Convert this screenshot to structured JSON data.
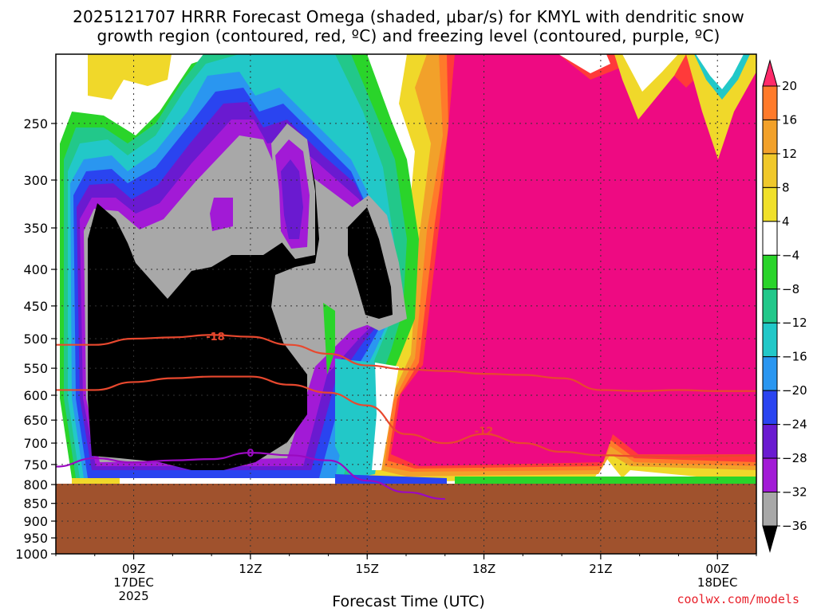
{
  "title_line1": "2025121707 HRRR Forecast Omega (shaded, μbar/s) for KMYL with dendritic snow",
  "title_line2": "growth region (contoured, red, ºC) and freezing level (contoured, purple, ºC)",
  "x_axis_title": "Forecast Time (UTC)",
  "credit": "coolwx.com/models",
  "colors": {
    "ground": "#a0522d",
    "contour_red": "#e8482e",
    "contour_purple": "#9a0ac0"
  },
  "chart_data": {
    "type": "heatmap",
    "title": "2025121707 HRRR Forecast Omega (shaded, μbar/s) for KMYL with dendritic snow growth region (contoured, red, ºC) and freezing level (contoured, purple, ºC)",
    "xlabel": "Forecast Time (UTC)",
    "ylabel": "",
    "x_range_hours": [
      7,
      25
    ],
    "y_scale": "log-pressure",
    "y_range_hpa": [
      200,
      1000
    ],
    "y_ticks": [
      250,
      300,
      350,
      400,
      450,
      500,
      550,
      600,
      650,
      700,
      750,
      800,
      850,
      900,
      950,
      1000
    ],
    "x_ticks": [
      {
        "hour": 9,
        "lines": [
          "09Z",
          "17DEC",
          "2025"
        ]
      },
      {
        "hour": 12,
        "lines": [
          "12Z"
        ]
      },
      {
        "hour": 15,
        "lines": [
          "15Z"
        ]
      },
      {
        "hour": 18,
        "lines": [
          "18Z"
        ]
      },
      {
        "hour": 21,
        "lines": [
          "21Z"
        ]
      },
      {
        "hour": 24,
        "lines": [
          "00Z",
          "18DEC"
        ]
      }
    ],
    "grid": "dotted",
    "surface_pressure_hpa": 840,
    "colorbar": {
      "levels": [
        20,
        16,
        12,
        8,
        4,
        -4,
        -8,
        -12,
        -16,
        -20,
        -24,
        -28,
        -32,
        -36
      ],
      "colors": [
        "#ff2a6a",
        "#ff7a2a",
        "#f2a12a",
        "#f0c82a",
        "#f0e02a",
        "#ffffff",
        "#2ad42a",
        "#22c88a",
        "#22c8c8",
        "#2a96f0",
        "#2a44f0",
        "#6a1ad0",
        "#a21ad6",
        "#a8a8a8",
        "#000000"
      ]
    },
    "contours": [
      {
        "name": "-18",
        "color": "red",
        "points": [
          [
            7,
            510
          ],
          [
            8,
            510
          ],
          [
            9,
            500
          ],
          [
            10,
            498
          ],
          [
            11,
            494
          ],
          [
            12,
            497
          ],
          [
            13,
            510
          ],
          [
            14,
            525
          ],
          [
            15,
            545
          ],
          [
            16,
            552
          ],
          [
            17,
            555
          ],
          [
            18,
            560
          ],
          [
            19,
            562
          ],
          [
            20,
            568
          ],
          [
            21,
            590
          ],
          [
            22,
            592
          ],
          [
            23,
            590
          ],
          [
            24,
            592
          ],
          [
            25,
            592
          ]
        ]
      },
      {
        "name": "-12",
        "color": "red",
        "points": [
          [
            7,
            590
          ],
          [
            8,
            590
          ],
          [
            9,
            575
          ],
          [
            10,
            568
          ],
          [
            11,
            565
          ],
          [
            12,
            565
          ],
          [
            13,
            580
          ],
          [
            14,
            595
          ],
          [
            15,
            620
          ],
          [
            16,
            680
          ],
          [
            17,
            700
          ],
          [
            18,
            680
          ],
          [
            19,
            700
          ],
          [
            20,
            720
          ],
          [
            21,
            728
          ],
          [
            22,
            730
          ],
          [
            23,
            732
          ],
          [
            24,
            730
          ],
          [
            25,
            728
          ]
        ]
      },
      {
        "name": "0",
        "color": "purple",
        "points": [
          [
            7,
            755
          ],
          [
            8,
            735
          ],
          [
            9,
            745
          ],
          [
            10,
            740
          ],
          [
            11,
            737
          ],
          [
            12,
            722
          ],
          [
            13,
            728
          ],
          [
            14,
            740
          ],
          [
            15,
            790
          ],
          [
            16,
            820
          ],
          [
            17,
            838
          ]
        ]
      }
    ],
    "contour_labels": [
      {
        "text": "-18",
        "hour": 11.1,
        "hpa": 496,
        "color": "red"
      },
      {
        "text": "-12",
        "hour": 18.0,
        "hpa": 673,
        "color": "red"
      },
      {
        "text": "0",
        "hour": 12.0,
        "hpa": 722,
        "color": "purple"
      }
    ],
    "shaded_regions": [
      {
        "value_range": [
          20,
          99
        ],
        "color_index": 0,
        "hours": [
          16.8,
          25
        ],
        "hpa": [
          200,
          790
        ],
        "shape": "pink-block"
      },
      {
        "value_range": [
          -99,
          -36
        ],
        "color_index": 14,
        "hours": [
          7.8,
          13.5
        ],
        "hpa": [
          320,
          810
        ],
        "shape": "black-core"
      },
      {
        "value_range": [
          -99,
          -36
        ],
        "color_index": 14,
        "hours": [
          14.6,
          15.6
        ],
        "hpa": [
          350,
          480
        ],
        "shape": "black-small"
      }
    ]
  }
}
